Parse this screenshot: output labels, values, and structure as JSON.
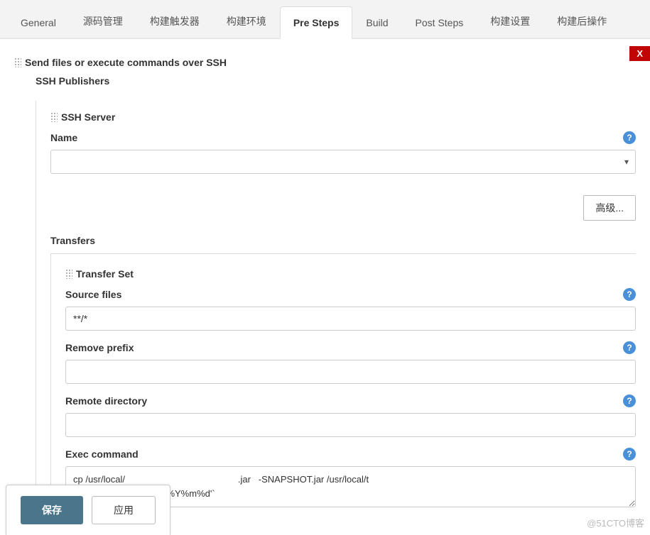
{
  "tabs": {
    "items": [
      {
        "label": "General"
      },
      {
        "label": "源码管理"
      },
      {
        "label": "构建触发器"
      },
      {
        "label": "构建环境"
      },
      {
        "label": "Pre Steps",
        "active": true
      },
      {
        "label": "Build"
      },
      {
        "label": "Post Steps"
      },
      {
        "label": "构建设置"
      },
      {
        "label": "构建后操作"
      }
    ]
  },
  "section": {
    "title": "Send files or execute commands over SSH",
    "publishers_label": "SSH Publishers",
    "delete": "X"
  },
  "ssh_server": {
    "heading": "SSH Server",
    "name_label": "Name",
    "name_value": "         ",
    "advanced_label": "高级..."
  },
  "transfers": {
    "heading": "Transfers",
    "set_heading": "Transfer Set",
    "source_files": {
      "label": "Source files",
      "value": "**/*"
    },
    "remove_prefix": {
      "label": "Remove prefix",
      "value": ""
    },
    "remote_directory": {
      "label": "Remote directory",
      "value": ""
    },
    "exec_command": {
      "label": "Exec command",
      "value": "cp /usr/local/                                            .jar   -SNAPSHOT.jar /usr/local/t                                   \nSNAPSHOT.jar`date '+%Y%m%d'`"
    }
  },
  "buttons": {
    "save": "保存",
    "apply": "应用"
  },
  "watermark": "@51CTO博客"
}
